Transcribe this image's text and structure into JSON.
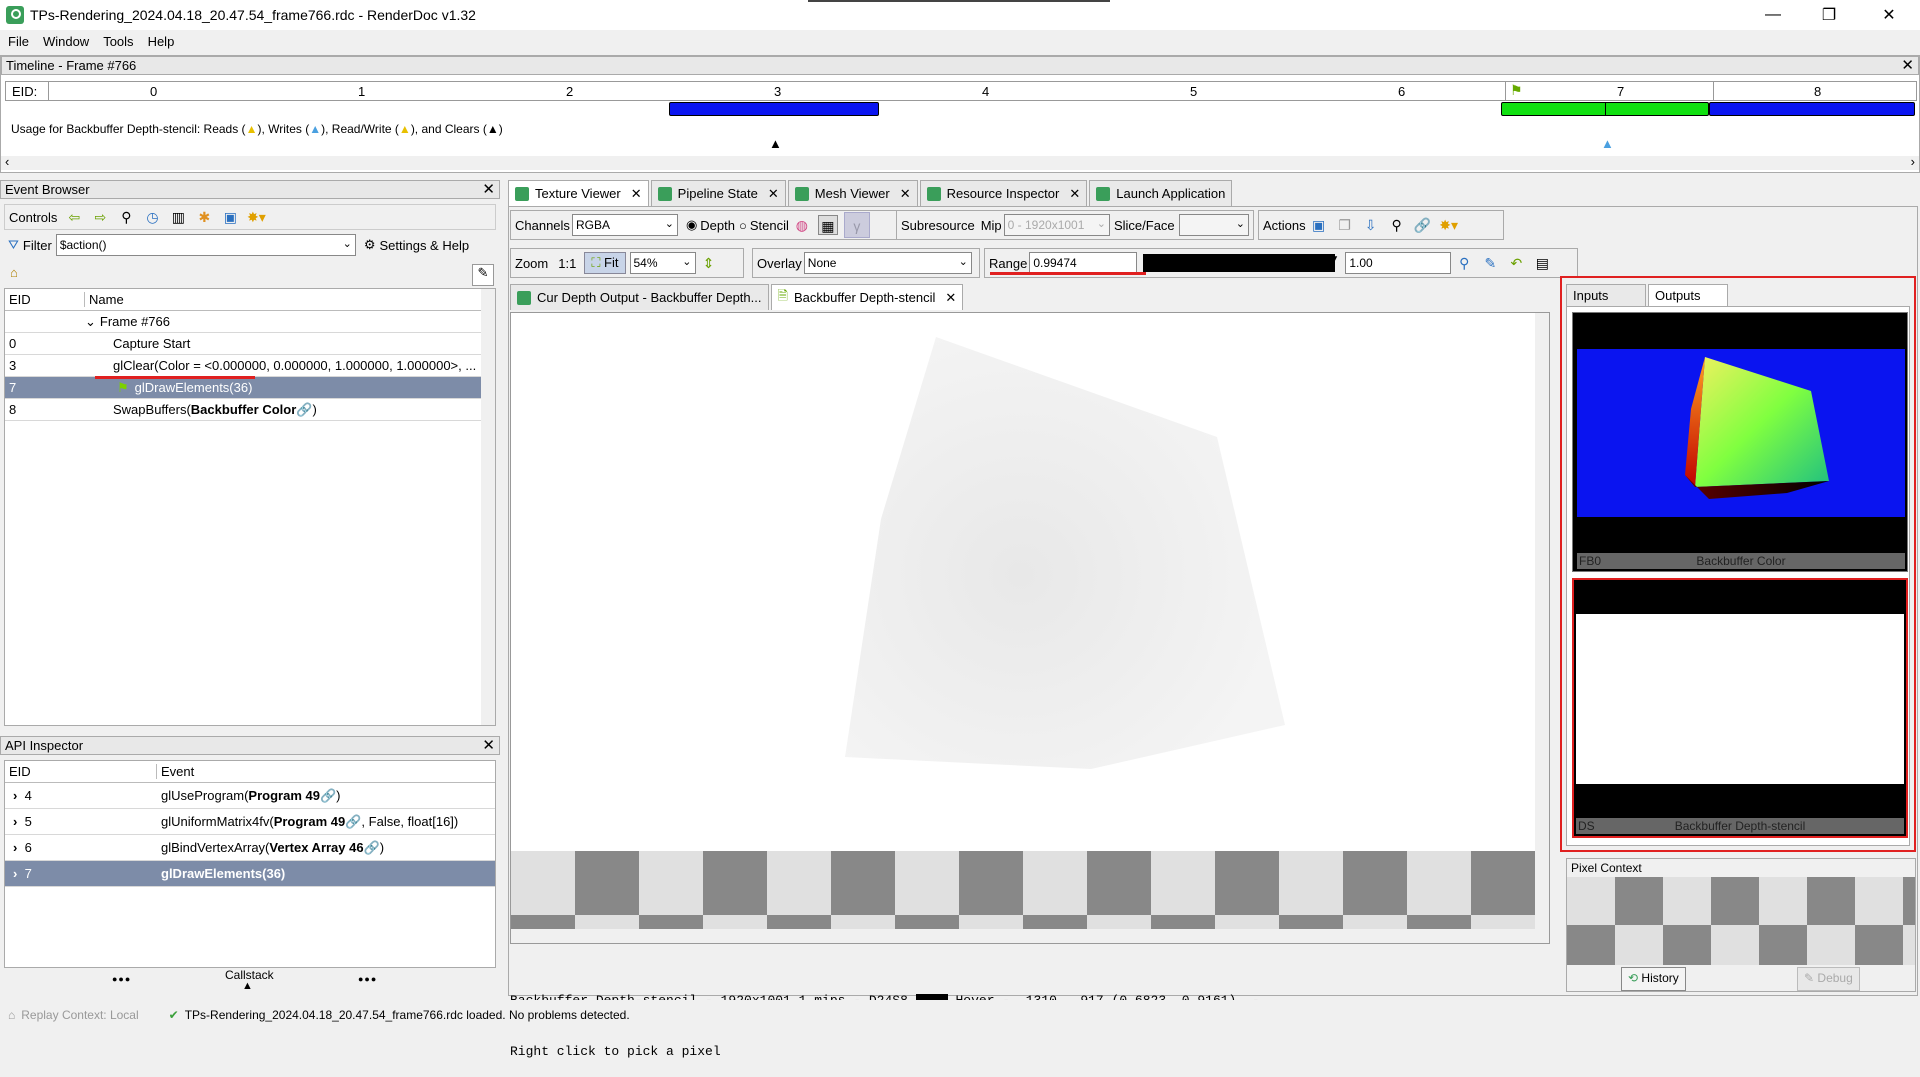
{
  "window": {
    "title": "TPs-Rendering_2024.04.18_20.47.54_frame766.rdc - RenderDoc v1.32",
    "min": "—",
    "max": "❐",
    "close": "✕"
  },
  "menu": [
    "File",
    "Window",
    "Tools",
    "Help"
  ],
  "timeline": {
    "title": "Timeline - Frame #766",
    "eid_label": "EID:",
    "ticks": [
      "0",
      "1",
      "2",
      "3",
      "4",
      "5",
      "6",
      "7",
      "8"
    ],
    "usage": "Usage for Backbuffer Depth-stencil:  Reads (",
    "usage_writes": "), Writes (",
    "usage_rw": "), Read/Write (",
    "usage_clears": "), and Clears (",
    "usage_end": ")"
  },
  "event_browser": {
    "title": "Event Browser",
    "controls": "Controls",
    "filter_label": "Filter",
    "filter_value": "$action()",
    "settings": "Settings & Help",
    "col_eid": "EID",
    "col_name": "Name",
    "rows": [
      {
        "eid": "",
        "name": "Frame #766"
      },
      {
        "eid": "0",
        "name": "Capture Start"
      },
      {
        "eid": "3",
        "name": "glClear(Color = <0.000000, 0.000000, 1.000000, 1.000000>, ..."
      },
      {
        "eid": "7",
        "name": "glDrawElements(36)"
      },
      {
        "eid": "8",
        "name": "SwapBuffers(",
        "bold": "Backbuffer Color",
        "end": ")"
      }
    ]
  },
  "api_inspector": {
    "title": "API Inspector",
    "col_eid": "EID",
    "col_event": "Event",
    "rows": [
      {
        "eid": "4",
        "pre": "glUseProgram(",
        "bold": "Program 49",
        "post": ")"
      },
      {
        "eid": "5",
        "pre": "glUniformMatrix4fv(",
        "bold": "Program 49",
        "post": ", False, float[16])"
      },
      {
        "eid": "6",
        "pre": "glBindVertexArray(",
        "bold": "Vertex Array 46",
        "post": ")"
      },
      {
        "eid": "7",
        "pre": "",
        "bold": "glDrawElements(36)",
        "post": ""
      }
    ],
    "callstack": "Callstack",
    "dots": "●●●"
  },
  "tabs": [
    "Texture Viewer",
    "Pipeline State",
    "Mesh Viewer",
    "Resource Inspector",
    "Launch Application"
  ],
  "toolbar": {
    "channels_label": "Channels",
    "channels": "RGBA",
    "depth": "Depth",
    "stencil": "Stencil",
    "subresource": "Subresource",
    "mip_label": "Mip",
    "mip": "0 - 1920x1001",
    "slice": "Slice/Face",
    "actions": "Actions",
    "zoom": "Zoom",
    "one": "1:1",
    "fit": "Fit",
    "zoom_val": "54%",
    "overlay_label": "Overlay",
    "overlay": "None",
    "range_label": "Range",
    "range_min": "0.99474",
    "range_max": "1.00"
  },
  "subtabs": [
    "Cur Depth Output - Backbuffer Depth...",
    "Backbuffer Depth-stencil"
  ],
  "status_text": {
    "line1": "Backbuffer Depth-stencil - 1920x1001 1 mips - D24S8",
    "hover": "Hover -  1310,  917 (0.6823, 0.9161)  -",
    "line2": "Right click to pick a pixel"
  },
  "right": {
    "tab_inputs": "Inputs",
    "tab_outputs": "Outputs",
    "fb0": "FB0",
    "fb0_name": "Backbuffer Color",
    "ds": "DS",
    "ds_name": "Backbuffer Depth-stencil",
    "pixel_context": "Pixel Context",
    "history": "History",
    "debug": "Debug"
  },
  "statusbar": {
    "replay": "Replay Context: Local",
    "msg": "TPs-Rendering_2024.04.18_20.47.54_frame766.rdc loaded. No problems detected."
  },
  "colors": {
    "accent": "#3a9e5a",
    "highlight_row": "#7d8ca8",
    "annotation_red": "#e02020",
    "timeline_blue": "#0a14f0",
    "timeline_green": "#10e010"
  }
}
